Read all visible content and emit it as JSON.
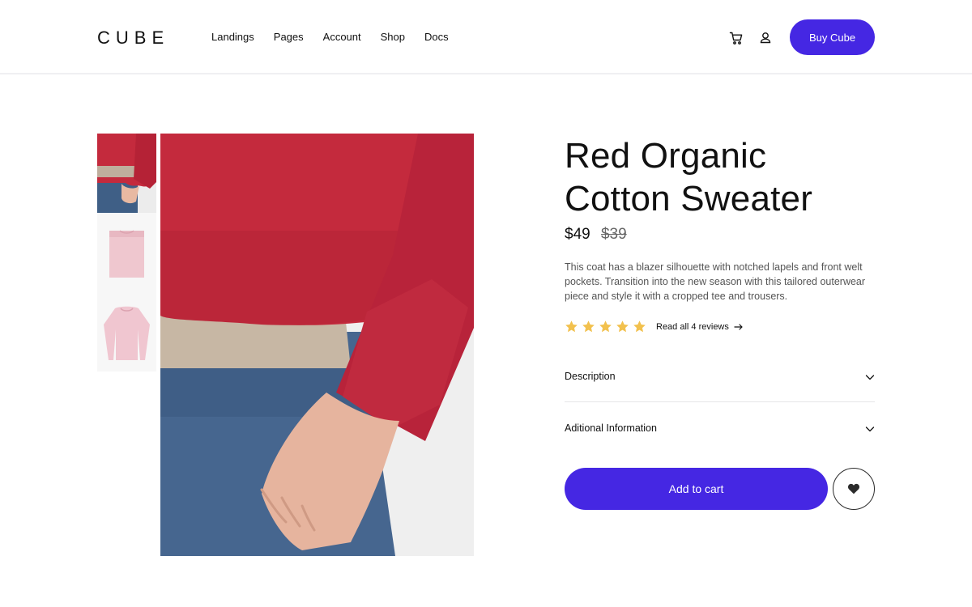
{
  "header": {
    "logo": "CUBE",
    "nav": [
      "Landings",
      "Pages",
      "Account",
      "Shop",
      "Docs"
    ],
    "cart_icon": "cart-icon",
    "user_icon": "user-icon",
    "cta_label": "Buy Cube"
  },
  "gallery": {
    "thumbnails": [
      "sweater-closeup-thumbnail",
      "pink-folded-sweater-thumbnail",
      "pink-sweater-flat-thumbnail"
    ],
    "main_image": "red-sweater-model-closeup"
  },
  "product": {
    "title_line1": "Red Organic",
    "title_line2": "Cotton Sweater",
    "price": "$49",
    "old_price": "$39",
    "description": "This coat has a blazer silhouette with notched lapels and front welt pockets. Transition into the new season with this tailored outerwear piece and style it with a cropped tee and trousers.",
    "rating_stars": 5,
    "reviews_link": "Read all 4 reviews"
  },
  "accordion": [
    {
      "label": "Description"
    },
    {
      "label": "Aditional Information"
    }
  ],
  "actions": {
    "add_to_cart": "Add to cart",
    "favorite_icon": "heart-icon"
  },
  "colors": {
    "accent": "#4527e3",
    "star": "#f2c14e",
    "sweater": "#c42a3d"
  }
}
